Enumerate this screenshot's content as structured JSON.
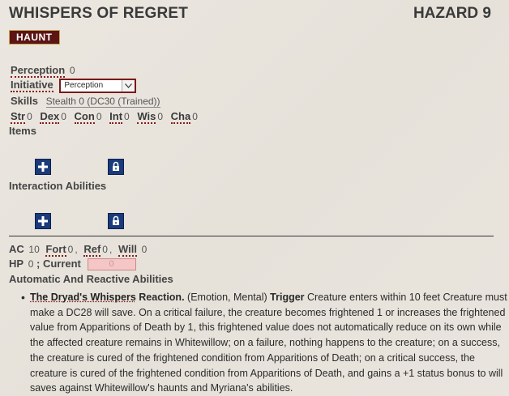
{
  "header": {
    "title": "WHISPERS OF REGRET",
    "level": "HAZARD 9"
  },
  "traits": [
    "HAUNT"
  ],
  "perception": {
    "label": "Perception",
    "value": "0"
  },
  "initiative": {
    "label": "Initiative",
    "selected": "Perception"
  },
  "skills": {
    "label": "Skills",
    "value": "Stealth 0 (DC30 (Trained))"
  },
  "abilities": [
    {
      "label": "Str",
      "value": "0"
    },
    {
      "label": "Dex",
      "value": "0"
    },
    {
      "label": "Con",
      "value": "0"
    },
    {
      "label": "Int",
      "value": "0"
    },
    {
      "label": "Wis",
      "value": "0"
    },
    {
      "label": "Cha",
      "value": "0"
    }
  ],
  "items_label": "Items",
  "interaction_label": "Interaction Abilities",
  "defense": {
    "ac_label": "AC",
    "ac_value": "10",
    "fort_label": "Fort",
    "fort_value": "0",
    "ref_label": "Ref",
    "ref_value": "0",
    "will_label": "Will",
    "will_value": "0",
    "hp_label": "HP",
    "hp_value": "0",
    "current_label": "; Current",
    "current_value": "0"
  },
  "auto_label": "Automatic And Reactive Abilities",
  "reaction": {
    "name": "The Dryad's Whispers",
    "action": "Reaction.",
    "traits": "(Emotion, Mental)",
    "trigger_label": "Trigger",
    "text": "Creature enters within 10 feet Creature must make a DC28 will save. On a critical failure, the creature becomes frightened 1 or increases the frightened value from Apparitions of Death by 1, this frightened value does not automatically reduce on its own while the affected creature remains in Whitewillow; on a failure, nothing happens to the creature; on a success, the creature is cured of the frightened condition from Apparitions of Death; on a critical success, the creature is cured of the frightened condition from Apparitions of Death, and gains a +1 status bonus to will saves against Whitewillow's haunts and Myriana's abilities."
  },
  "icons": {
    "add": "plus-icon",
    "lock": "lock-icon"
  }
}
